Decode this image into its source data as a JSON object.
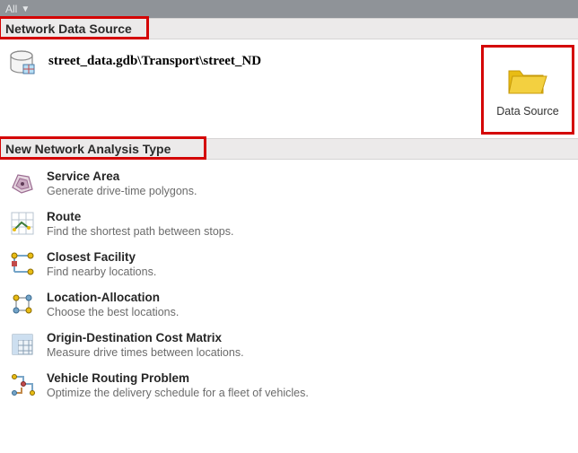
{
  "topbar": {
    "filter_label": "All"
  },
  "sections": {
    "data_source_header": "Network Data Source",
    "analysis_type_header": "New Network Analysis Type"
  },
  "data_source": {
    "path": "street_data.gdb\\Transport\\street_ND",
    "button_label": "Data Source"
  },
  "analysis": [
    {
      "title": "Service Area",
      "desc": "Generate drive-time polygons."
    },
    {
      "title": "Route",
      "desc": "Find the shortest path between stops."
    },
    {
      "title": "Closest Facility",
      "desc": "Find nearby locations."
    },
    {
      "title": "Location-Allocation",
      "desc": "Choose the best locations."
    },
    {
      "title": "Origin-Destination Cost Matrix",
      "desc": "Measure drive times between locations."
    },
    {
      "title": "Vehicle Routing Problem",
      "desc": "Optimize the delivery schedule for a fleet of vehicles."
    }
  ],
  "colors": {
    "highlight_red": "#d40303",
    "folder_yellow": "#e8bc14"
  }
}
